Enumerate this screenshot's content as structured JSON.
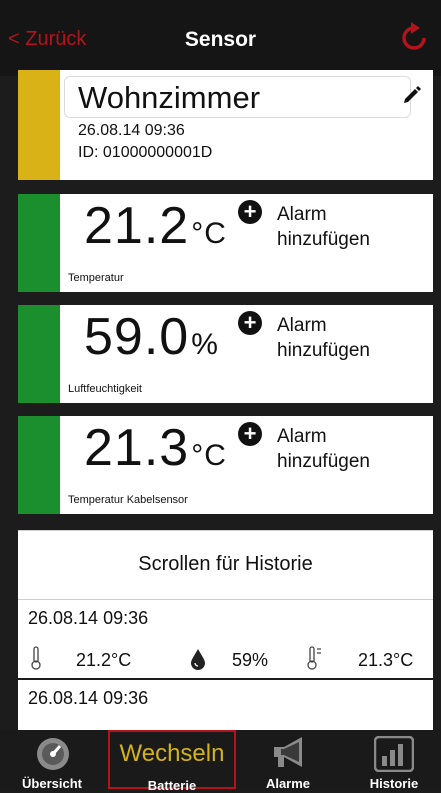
{
  "nav": {
    "back_label": "< Zurück",
    "title": "Sensor",
    "refresh_icon": "refresh-icon"
  },
  "sensor": {
    "name": "Wohnzimmer",
    "datetime": "26.08.14   09:36",
    "id": "ID: 01000000001D",
    "status_color": "#d8b216"
  },
  "readings": [
    {
      "value": "21.2",
      "unit": "°C",
      "alarm": "Alarm hinzufügen",
      "label": "Temperatur",
      "color": "#1b8f2e"
    },
    {
      "value": "59.0",
      "unit": "%",
      "alarm": "Alarm hinzufügen",
      "label": "Luftfeuchtigkeit",
      "color": "#1b8f2e"
    },
    {
      "value": "21.3",
      "unit": "°C",
      "alarm": "Alarm hinzufügen",
      "label": "Temperatur Kabelsensor",
      "color": "#1b8f2e"
    }
  ],
  "history": {
    "scroll_label": "Scrollen für Historie",
    "entries": [
      {
        "datetime": "26.08.14   09:36",
        "temp": "21.2°C",
        "humidity": "59%",
        "cable_temp": "21.3°C"
      },
      {
        "datetime": "26.08.14   09:36"
      }
    ]
  },
  "tabs": [
    {
      "label": "Übersicht",
      "icon": "gauge-icon"
    },
    {
      "label": "Batterie",
      "top_text": "Wechseln",
      "icon": "battery-icon",
      "active": true
    },
    {
      "label": "Alarme",
      "icon": "megaphone-icon"
    },
    {
      "label": "Historie",
      "icon": "bar-chart-icon"
    }
  ],
  "colors": {
    "accent": "#b3141c",
    "battery_text": "#d3b21a"
  }
}
